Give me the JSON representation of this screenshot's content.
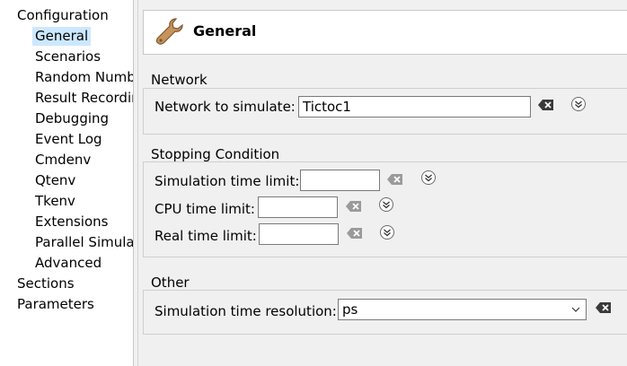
{
  "tree": {
    "items": [
      {
        "label": "Configuration",
        "level": 0,
        "selected": false
      },
      {
        "label": "General",
        "level": 1,
        "selected": true
      },
      {
        "label": "Scenarios",
        "level": 1,
        "selected": false
      },
      {
        "label": "Random Numb",
        "level": 1,
        "selected": false
      },
      {
        "label": "Result Recordin",
        "level": 1,
        "selected": false
      },
      {
        "label": "Debugging",
        "level": 1,
        "selected": false
      },
      {
        "label": "Event Log",
        "level": 1,
        "selected": false
      },
      {
        "label": "Cmdenv",
        "level": 1,
        "selected": false
      },
      {
        "label": "Qtenv",
        "level": 1,
        "selected": false
      },
      {
        "label": "Tkenv",
        "level": 1,
        "selected": false
      },
      {
        "label": "Extensions",
        "level": 1,
        "selected": false
      },
      {
        "label": "Parallel Simulat",
        "level": 1,
        "selected": false
      },
      {
        "label": "Advanced",
        "level": 1,
        "selected": false
      },
      {
        "label": "Sections",
        "level": 0,
        "selected": false
      },
      {
        "label": "Parameters",
        "level": 0,
        "selected": false
      }
    ]
  },
  "header": {
    "title": "General",
    "icon": "wrench-icon"
  },
  "network": {
    "title": "Network",
    "label": "Network to simulate:",
    "value": "Tictoc1"
  },
  "stopping": {
    "title": "Stopping Condition",
    "sim_time_label": "Simulation time limit:",
    "sim_time_value": "",
    "cpu_time_label": "CPU time limit:",
    "cpu_time_value": "",
    "real_time_label": "Real time limit:",
    "real_time_value": ""
  },
  "other": {
    "title": "Other",
    "resolution_label": "Simulation time resolution:",
    "resolution_value": "ps"
  },
  "colors": {
    "selection": "#cce8ff",
    "panel_bg": "#f0f0f0",
    "field_border": "#7a7a7a"
  }
}
